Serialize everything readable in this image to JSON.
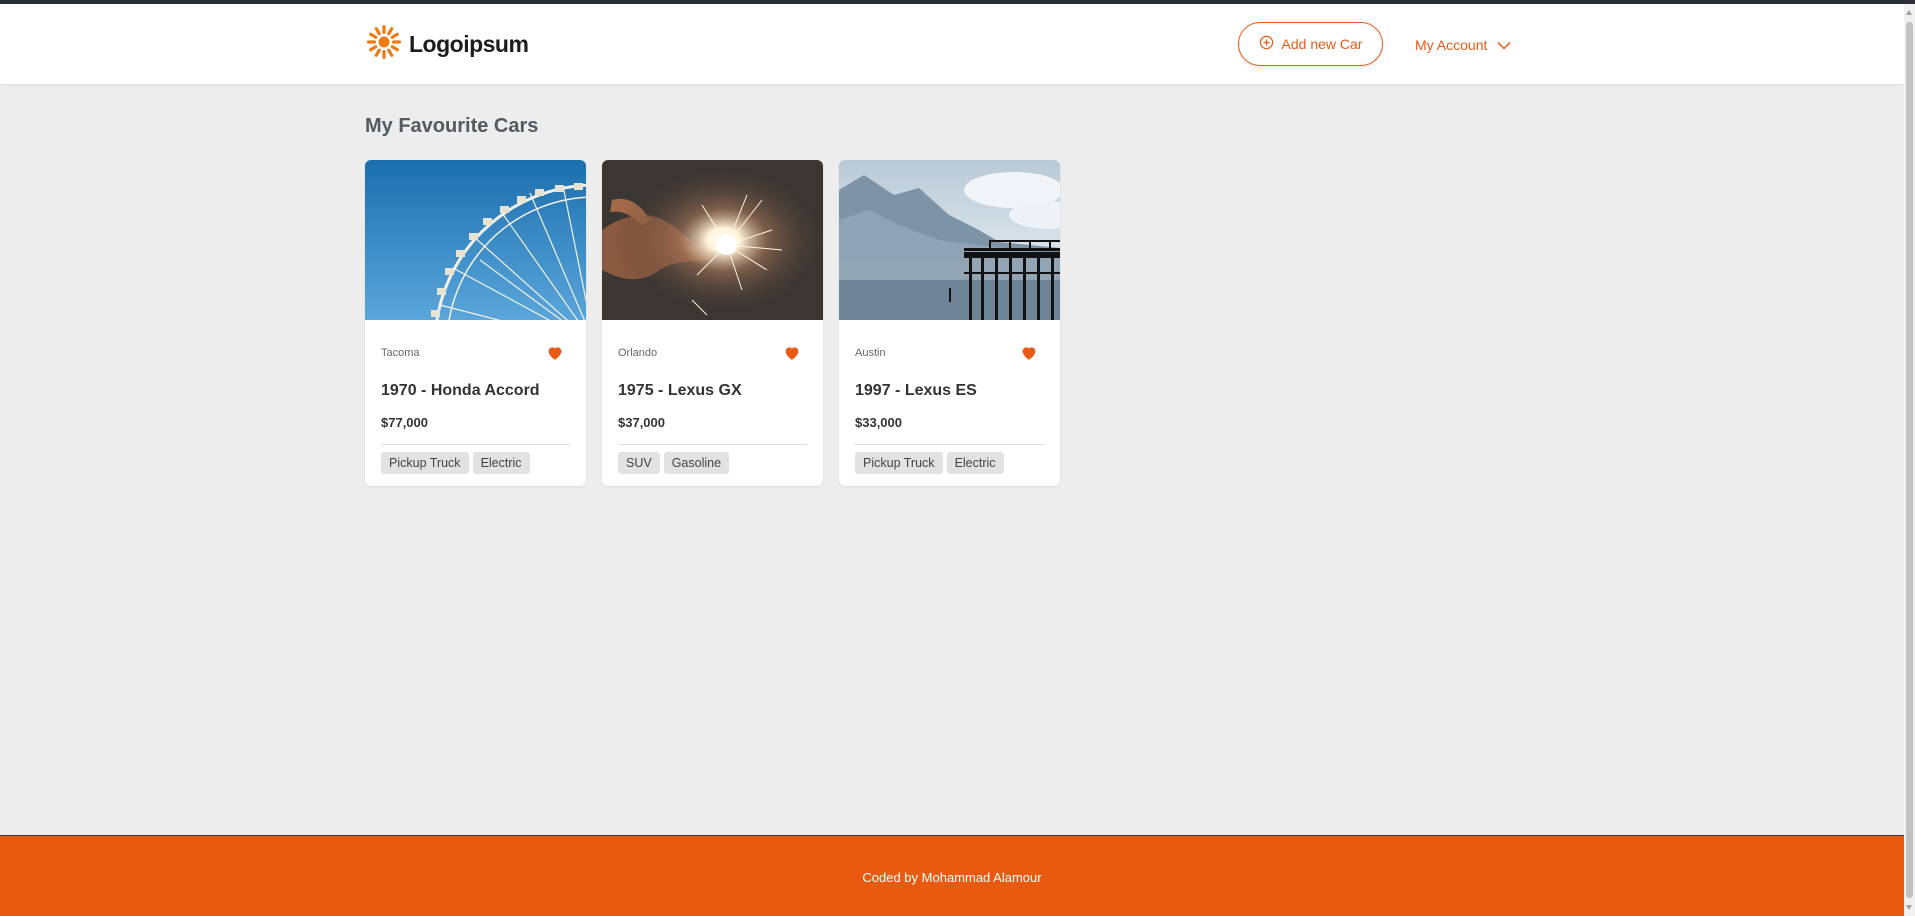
{
  "header": {
    "logo_text": "Logoipsum",
    "add_button_label": "Add new Car",
    "account_label": "My Account"
  },
  "page": {
    "title": "My Favourite Cars"
  },
  "cards": [
    {
      "city": "Tacoma",
      "title": "1970 - Honda Accord",
      "price": "$77,000",
      "tags": [
        "Pickup Truck",
        "Electric"
      ],
      "image": "ferris-wheel"
    },
    {
      "city": "Orlando",
      "title": "1975 - Lexus GX",
      "price": "$37,000",
      "tags": [
        "SUV",
        "Gasoline"
      ],
      "image": "sparkler"
    },
    {
      "city": "Austin",
      "title": "1997 - Lexus ES",
      "price": "$33,000",
      "tags": [
        "Pickup Truck",
        "Electric"
      ],
      "image": "lake-pier"
    }
  ],
  "footer": {
    "text": "Coded by Mohammad Alamour"
  },
  "colors": {
    "accent": "#e85a14",
    "footer_bg": "#e85a0f",
    "page_bg": "#ededed"
  },
  "icons": {
    "logo": "sunburst-logo-icon",
    "add": "plus-circle-icon",
    "account": "chevron-down-icon",
    "favourite": "heart-icon"
  }
}
